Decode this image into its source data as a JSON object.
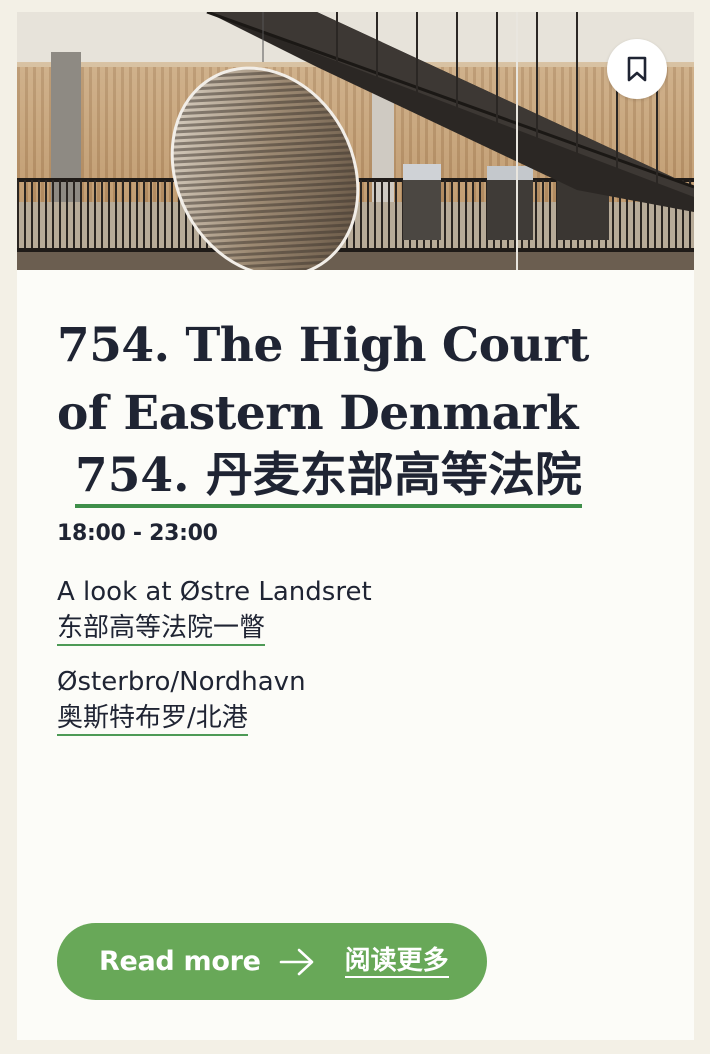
{
  "card": {
    "title": "754. The High Court of Eastern Denmark",
    "title_zh": "754. 丹麦东部高等法院",
    "time": "18:00 - 23:00",
    "description": "A look at Østre Landsret",
    "description_zh": "东部高等法院一瞥",
    "area": "Østerbro/Nordhavn",
    "area_zh": "奥斯特布罗/北港",
    "bookmark_icon": "bookmark-icon",
    "read_more": {
      "label": "Read more",
      "label_zh": "阅读更多",
      "icon": "arrow-right-icon"
    }
  },
  "colors": {
    "page_background": "#f3f0e6",
    "card_background": "#fcfcf8",
    "text": "#1f2433",
    "accent_green": "#68a858",
    "underline_green": "#3f8f4a"
  }
}
